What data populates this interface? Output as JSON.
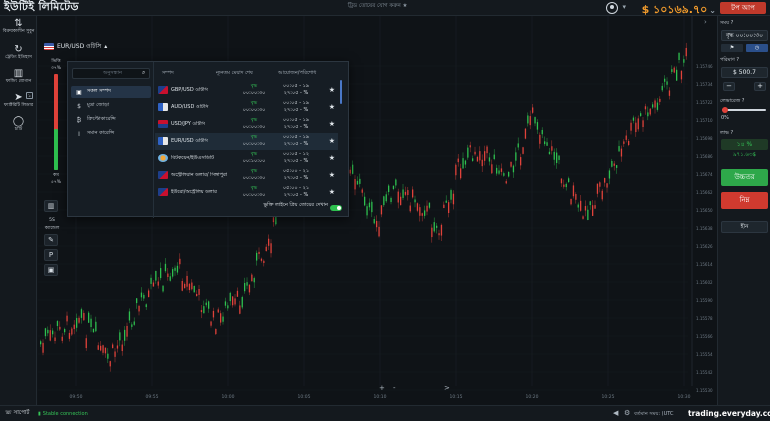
{
  "header": {
    "brand": "ইউটিই লিমিটেড",
    "balance": "$ ১০১৬৯.৭০",
    "balance_suffix": "⌄",
    "deposit_label": "টপ আপ",
    "hint": "ট্রিড তোয়ের যোগ করুন ★"
  },
  "sidebar": {
    "items": [
      {
        "icon": "⇅",
        "label": "বিক্রয়কালীন সুবুন"
      },
      {
        "icon": "↻",
        "label": "ট্রেডিং ইতিহাস"
      },
      {
        "icon": "▥",
        "label": "ফান্ডিং যোগান"
      },
      {
        "icon": "➤",
        "label": "ফ্যাক্টরিটি লিডার"
      },
      {
        "icon": "◯",
        "label": "চ্যাট"
      }
    ],
    "badge": "১"
  },
  "chart": {
    "asset": "EUR/USD ওটিসি",
    "sentiment_top_label": "ভিত্তি",
    "sentiment_top_pct": "৩৭%",
    "sentiment_bottom_label": "কম",
    "sentiment_bottom_pct": "৫৭%",
    "sentiment_up_fraction": 0.43,
    "timeframe_label": "5S",
    "timeframe_sub": "ক্যান্ডেল",
    "tool_icon_chart": "▥",
    "tool_icon_draw": "✎",
    "tool_icon_p": "P",
    "tool_icon_cube": "▣",
    "zoom_plus": "+",
    "zoom_minus": "-",
    "zoom_next": ">",
    "price_labels": [
      "1.15746",
      "1.15734",
      "1.15722",
      "1.15710",
      "1.15698",
      "1.15686",
      "1.15674",
      "1.15662",
      "1.15650",
      "1.15638",
      "1.15626",
      "1.15614",
      "1.15602",
      "1.15590",
      "1.15578",
      "1.15566",
      "1.15554",
      "1.15542",
      "1.15530"
    ],
    "time_labels": [
      "09:50",
      "09:55",
      "10:00",
      "10:05",
      "10:10",
      "10:15",
      "10:20",
      "10:25",
      "10:30"
    ]
  },
  "panel": {
    "search_placeholder": "অনুসন্ধান",
    "categories": [
      {
        "icon": "▣",
        "label": "সকল সম্পদ",
        "active": true
      },
      {
        "icon": "$",
        "label": "মুদ্রা জোড়া",
        "active": false
      },
      {
        "icon": "₿",
        "label": "ক্রিপ্টোকারেন্সি",
        "active": false
      },
      {
        "icon": "I",
        "label": "সমান কারেন্সি",
        "active": false
      }
    ],
    "columns": {
      "asset": "সম্পদ",
      "min_time": "ন্যূনতম মেয়াদ শেষ",
      "payout": "আয়োজন/পরিশোধ"
    },
    "rows": [
      {
        "flag": "flag-a",
        "name": "GBP/USD ওটিসি",
        "up": "বৃদ্ধ",
        "time": "০০:০০:৩০",
        "p1": "০০:০৫ - ১৯",
        "p2": "২৭:০৫ - %",
        "sel": false
      },
      {
        "flag": "flag-b",
        "name": "AUD/USD ওটিসি",
        "up": "বৃদ্ধ",
        "time": "০০:০০:৩০",
        "p1": "০০:০৫ - ১৯",
        "p2": "২৭:০৫ - %",
        "sel": false
      },
      {
        "flag": "flag-d",
        "name": "USD/JPY ওটিসি",
        "up": "বৃদ্ধ",
        "time": "০০:০০:৩০",
        "p1": "০০:০৫ - ১৯",
        "p2": "২৭:০৫ - %",
        "sel": false
      },
      {
        "flag": "flag-b",
        "name": "EUR/USD ওটিসি",
        "up": "বৃদ্ধ",
        "time": "০০:০০:৩০",
        "p1": "০০:০৫ - ১৯",
        "p2": "২৭:০৫ - %",
        "sel": true
      },
      {
        "flag": "flag-c",
        "name": "বিটকয়েন/ইউএসডিটি",
        "up": "বৃদ্ধ",
        "time": "০০:১০:০০",
        "p1": "০০:০৫ - ১২",
        "p2": "২৭:০৫ - %",
        "sel": false
      },
      {
        "flag": "flag-a",
        "name": "অস্ট্রেলিয়ান ডলার/ সিঙ্গাপুরা",
        "up": "বৃদ্ধ",
        "time": "০০:০০:৩০",
        "p1": "০৫:০০ - ২১",
        "p2": "২৭:০৫ - %",
        "sel": false
      },
      {
        "flag": "flag-a",
        "name": "ইউরো/অস্ট্রেলিয় ডলার",
        "up": "বৃদ্ধ",
        "time": "০০:০০:৩০",
        "p1": "০৫:০০ - ২১",
        "p2": "২৭:০৫ - %",
        "sel": false
      }
    ],
    "footer": "ভুক্তি লাইনে প্রিয় তোয়ের দেখান"
  },
  "right": {
    "time_label": "সময়",
    "time_value": "বৃদ্ধ ০০:০০:৩০",
    "amount_label": "পরিমাণ",
    "amount_value": "$ 500.7",
    "minus": "−",
    "plus": "+",
    "leverage_label": "লেভারেজ",
    "leverage_value": "0%",
    "payout_label": "লাভ",
    "payout_value": "১৪ %",
    "profit_value": "৯৭১.৬৩$",
    "up_label": "উচ্চতর",
    "down_label": "নিম্ন",
    "pending_label": "হীন",
    "mini_flag": "⚑",
    "mini_clock": "◷",
    "info_icon": "?"
  },
  "footer": {
    "support": "সাপোর্ট",
    "connection": "Stable connection",
    "server_time_label": "বর্তমান সময়: (UTC",
    "watermark": "trading.everyday.com"
  },
  "colors": {
    "bull": "#2ec04f",
    "bear": "#e0423a",
    "accent": "#f39c2c"
  }
}
